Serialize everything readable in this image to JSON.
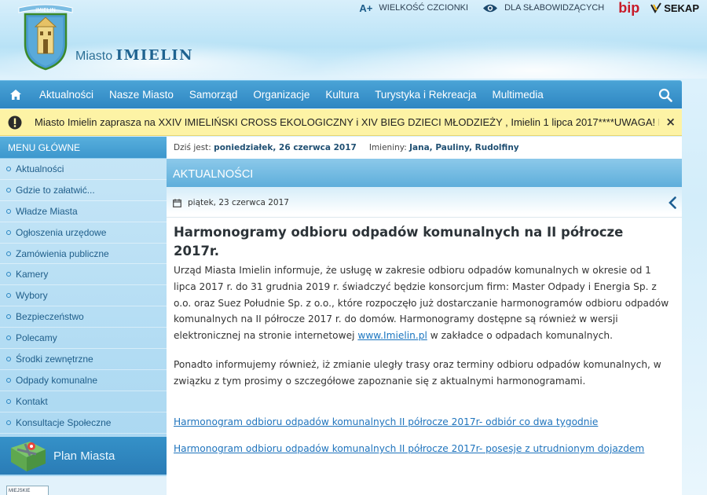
{
  "header": {
    "site_prefix": "Miasto",
    "site_name": "IMIELIN",
    "crest_banner": "IMIELIN",
    "topbar": {
      "font_size_label": "WIELKOŚĆ CZCIONKI",
      "font_size_icon": "A+",
      "accessibility_label": "DLA SŁABOWIDZĄCYCH",
      "bip_label": "bip",
      "sekap_label": "SEKAP"
    }
  },
  "nav": {
    "items": [
      "Aktualności",
      "Nasze Miasto",
      "Samorząd",
      "Organizacje",
      "Kultura",
      "Turystyka i Rekreacja",
      "Multimedia"
    ]
  },
  "alert": {
    "message": "Miasto Imielin zaprasza na XXIV IMIELIŃSKI CROSS EKOLOGICZNY i XIV BIEG DZIECI MŁODZIEŻY , Imielin 1 lipca 2017****UWAGA! Dostępne są",
    "close": "×"
  },
  "sidebar": {
    "heading": "MENU GŁÓWNE",
    "items": [
      "Aktualności",
      "Gdzie to załatwić...",
      "Władze Miasta",
      "Ogłoszenia urzędowe",
      "Zamówienia publiczne",
      "Kamery",
      "Wybory",
      "Bezpieczeństwo",
      "Polecamy",
      "Środki zewnętrzne",
      "Odpady komunalne",
      "Kontakt",
      "Konsultacje Społeczne"
    ],
    "plan_label": "Plan Miasta",
    "mini_logo_text": "MIEJSKIE"
  },
  "main": {
    "today_label": "Dziś jest:",
    "today_value": "poniedziałek, 26 czerwca 2017",
    "names_label": "Imieniny:",
    "names_value": "Jana, Pauliny, Rudolfiny",
    "section_title": "AKTUALNOŚCI",
    "post_date": "piątek, 23 czerwca 2017",
    "article_title": "Harmonogramy odbioru odpadów komunalnych na II półrocze 2017r.",
    "paragraph1_before_link": "Urząd Miasta Imielin informuje, że usługę w zakresie odbioru odpadów komunalnych w okresie od 1 lipca 2017 r. do 31 grudnia 2019 r. świadczyć będzie konsorcjum firm: Master Odpady i Energia Sp. z o.o. oraz Suez Południe Sp. z o.o., które rozpoczęło już dostarczanie harmonogramów odbioru odpadów komunalnych na II półrocze 2017 r. do domów. Harmonogramy dostępne są również w wersji elektronicznej na stronie internetowej ",
    "paragraph1_link": "www.Imielin.pl",
    "paragraph1_after_link": "  w zakładce o odpadach komunalnych.",
    "paragraph2": "Ponadto informujemy również, iż  zmianie uległy trasy oraz terminy odbioru odpadów komunalnych, w związku z tym prosimy o szczegółowe zapoznanie się z aktualnymi harmonogramami.",
    "download1": "Harmonogram odbioru odpadów komunalnych II półrocze 2017r- odbiór co dwa tygodnie",
    "download2": "Harmonogram odbioru odpadów komunalnych II półrocze 2017r- posesje z utrudnionym dojazdem"
  },
  "colors": {
    "nav_blue": "#2e86c2",
    "alert_yellow": "#fdf3a5",
    "link_blue": "#1a75c0",
    "bip_red": "#c81a28"
  },
  "icons": {
    "home": "home-icon",
    "search": "search-icon",
    "alert": "exclamation-icon",
    "eye": "eye-icon",
    "calendar": "calendar-icon",
    "back": "chevron-left-icon",
    "map": "map-icon"
  }
}
